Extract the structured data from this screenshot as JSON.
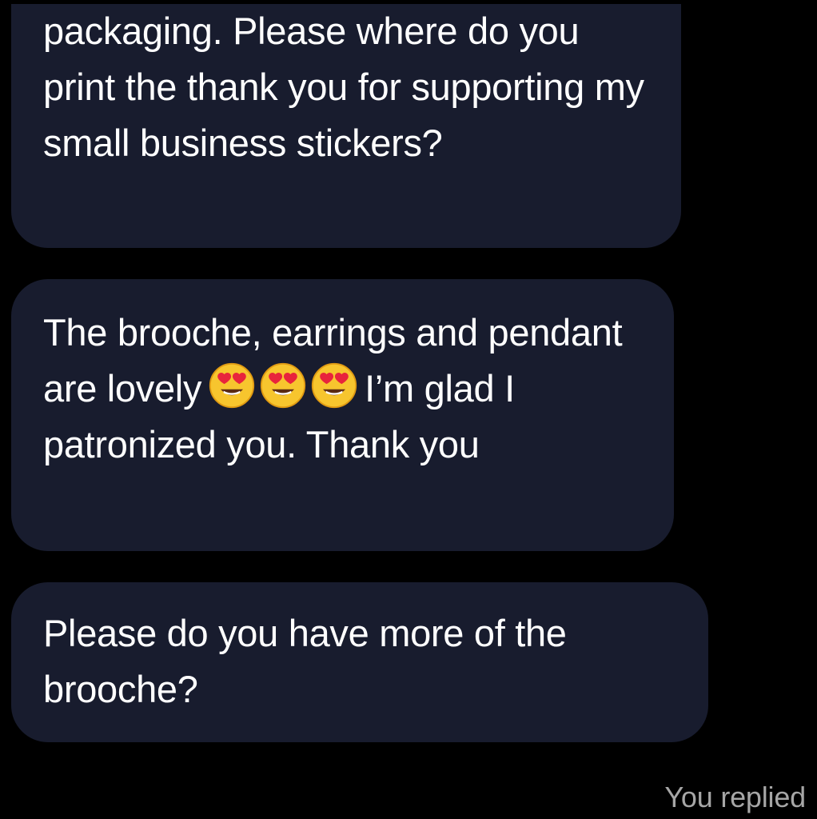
{
  "messages": [
    {
      "text": "packaging. Please where do you print the thank you for supporting my small business stickers?"
    },
    {
      "text_before_emoji": "The brooche, earrings and pendant are lovely",
      "emoji": [
        "smiling-face-with-heart-eyes",
        "smiling-face-with-heart-eyes",
        "smiling-face-with-heart-eyes"
      ],
      "text_after_emoji": "I’m glad I patronized you. Thank you"
    },
    {
      "text": "Please do you have more of the brooche?"
    }
  ],
  "status": {
    "replied_label": "You replied"
  },
  "colors": {
    "background": "#000000",
    "bubble": "#181c2e",
    "text": "#ffffff",
    "status_text": "#a6a6a6"
  }
}
